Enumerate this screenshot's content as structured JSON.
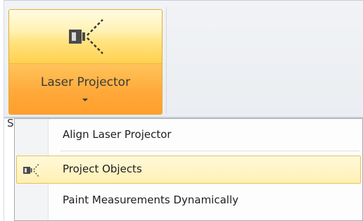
{
  "ribbon": {
    "button": {
      "label": "Laser Projector",
      "icon": "laser-projector-icon"
    },
    "partial_text": "S"
  },
  "menu": {
    "items": [
      {
        "label": "Align Laser Projector",
        "icon": null,
        "highlighted": false
      },
      {
        "label": "Project Objects",
        "icon": "laser-projector-icon",
        "highlighted": true
      },
      {
        "label": "Paint Measurements Dynamically",
        "icon": null,
        "highlighted": false
      }
    ]
  },
  "colors": {
    "button_top": "#ffe27c",
    "button_bottom": "#ffa93a",
    "highlight": "#fff2b5",
    "highlight_border": "#e7c25c"
  }
}
